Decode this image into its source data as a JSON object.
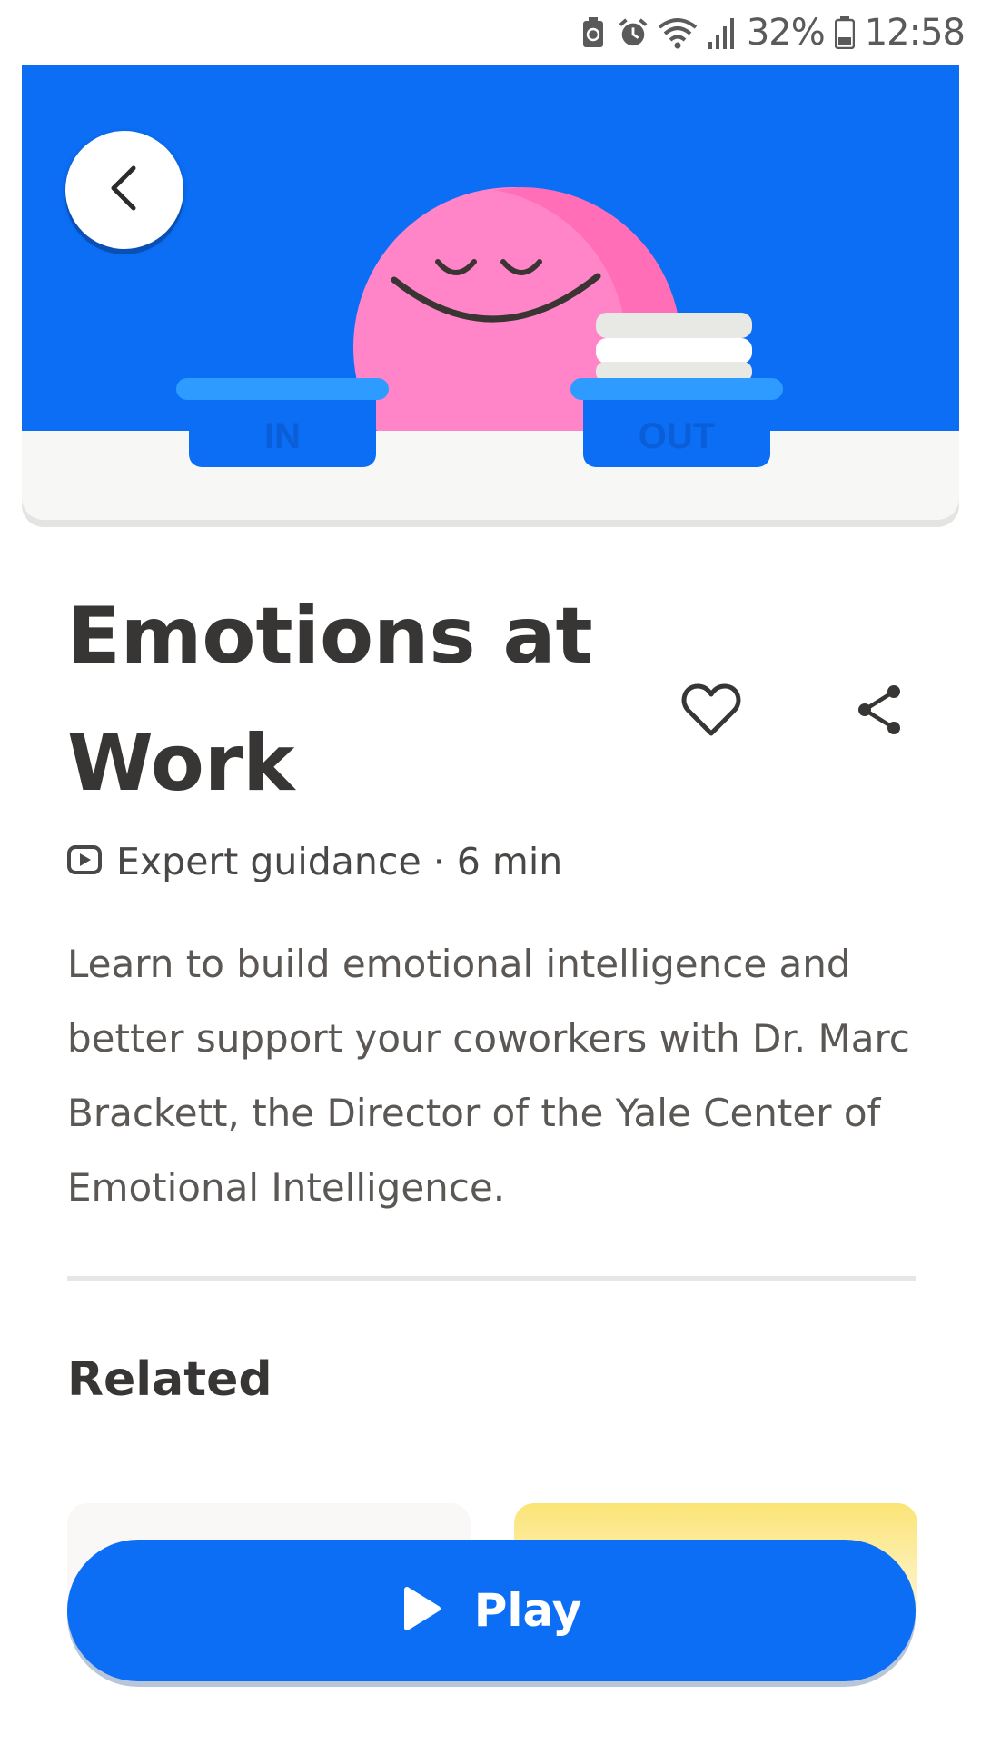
{
  "status_bar": {
    "battery_percent": "32%",
    "time": "12:58",
    "icons": [
      "battery-saver-icon",
      "alarm-icon",
      "wifi-icon",
      "signal-icon",
      "battery-icon"
    ]
  },
  "hero": {
    "tray_in_label": "IN",
    "tray_out_label": "OUT",
    "colors": {
      "background": "#0b6ef5",
      "character": "#ff85c8",
      "tray": "#0b6ef5",
      "tray_rim": "#2d9bff"
    }
  },
  "back_button": {
    "icon": "chevron-left-icon"
  },
  "session": {
    "title": "Emotions at Work",
    "meta": "Expert guidance · 6 min",
    "description": "Learn to build emotional intelligence and better support your coworkers with Dr. Marc Brackett, the Director of the Yale Center of Emotional Intelligence."
  },
  "actions": {
    "favorite_icon": "heart-icon",
    "share_icon": "share-icon"
  },
  "related": {
    "heading": "Related"
  },
  "play_button": {
    "label": "Play",
    "icon": "play-icon",
    "color": "#0b6ef5"
  }
}
